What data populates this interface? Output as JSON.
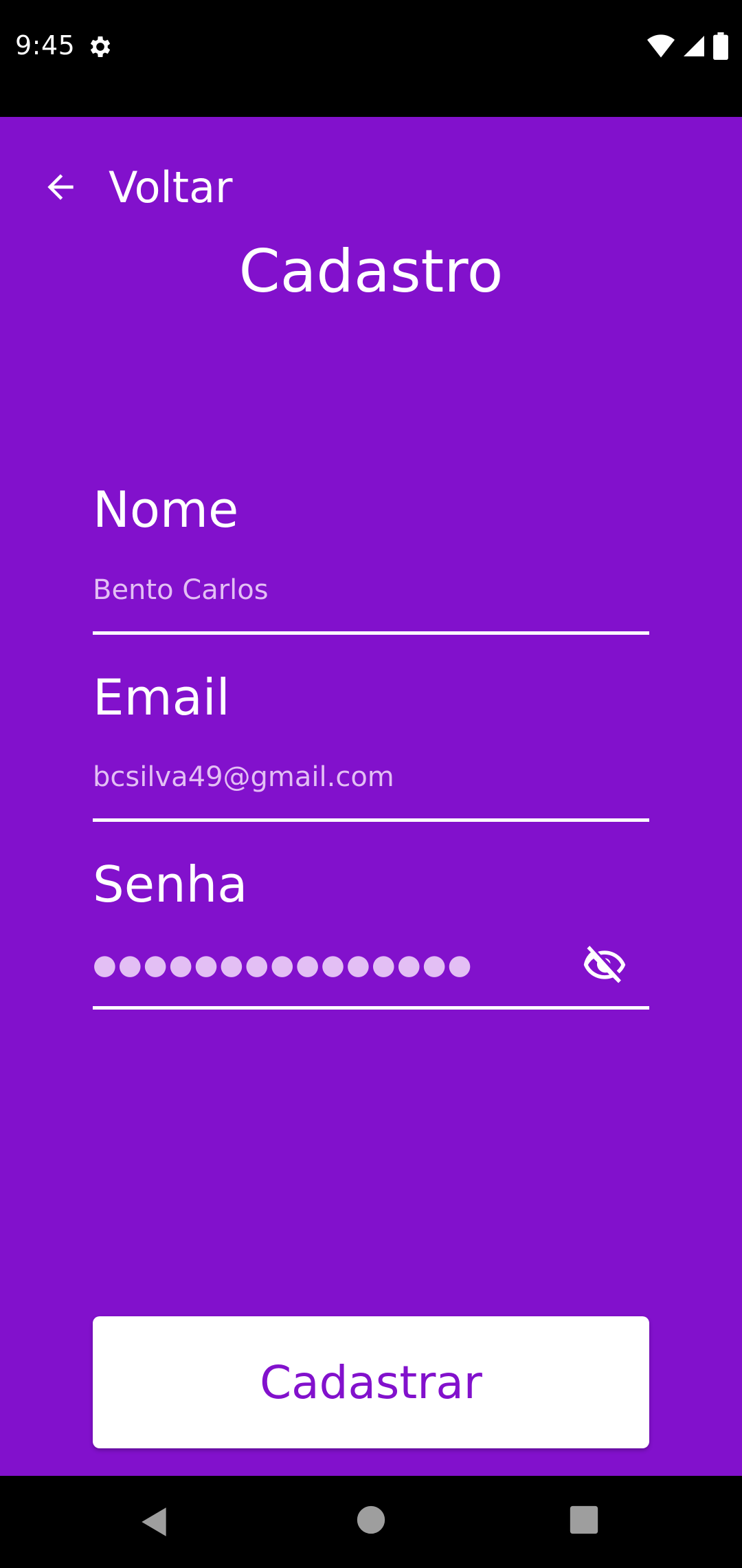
{
  "status_bar": {
    "time": "9:45",
    "icons": [
      "settings-gear-icon",
      "wifi-icon",
      "cellular-signal-icon",
      "battery-icon"
    ]
  },
  "header": {
    "back_label": "Voltar",
    "back_icon": "arrow-left-icon",
    "title": "Cadastro"
  },
  "form": {
    "name": {
      "label": "Nome",
      "value": "Bento Carlos"
    },
    "email": {
      "label": "Email",
      "value": "bcsilva49@gmail.com"
    },
    "password": {
      "label": "Senha",
      "masked_value": "●●●●●●●●●●●●●●●",
      "toggle_icon": "eye-off-icon"
    }
  },
  "actions": {
    "submit_label": "Cadastrar"
  },
  "nav_bar": {
    "buttons": [
      "back-triangle-icon",
      "home-circle-icon",
      "recents-square-icon"
    ]
  },
  "colors": {
    "primary": "#8211cc",
    "input_text": "#e3bff4",
    "white": "#ffffff"
  }
}
